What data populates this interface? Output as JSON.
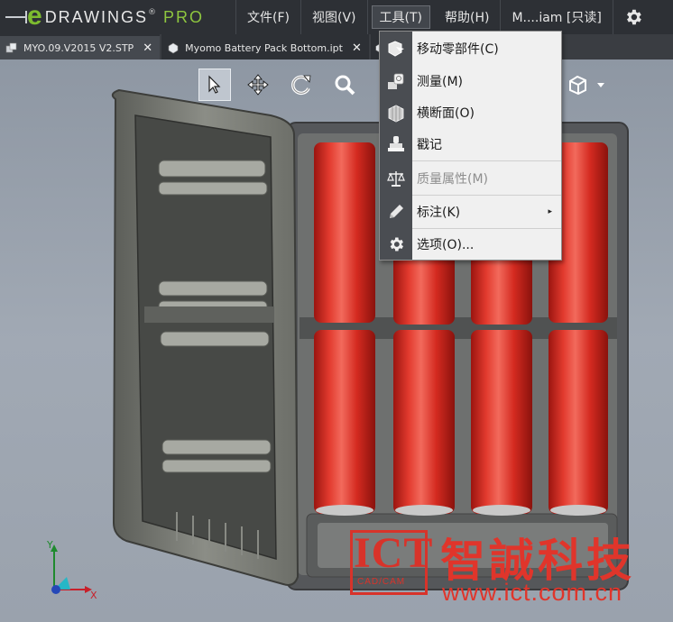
{
  "app": {
    "logo_e": "e",
    "logo_drawings": "DRAWINGS",
    "logo_reg": "®",
    "logo_pro": "PRO"
  },
  "menu": {
    "items": [
      {
        "label": "文件(F)"
      },
      {
        "label": "视图(V)"
      },
      {
        "label": "工具(T)"
      },
      {
        "label": "帮助(H)"
      },
      {
        "label": "M....iam [只读]"
      }
    ],
    "gear_icon": "gear-icon"
  },
  "tabs": [
    {
      "label": "MYO.09.V2015 V2.STP",
      "close": "✕"
    },
    {
      "label": "Myomo Battery Pack Bottom.ipt",
      "close": "✕"
    }
  ],
  "toolbar": {
    "icons": [
      "select-arrow-icon",
      "pan-icon",
      "rotate-icon",
      "zoom-fit-icon",
      "view-cube-icon",
      "dropdown-caret-icon"
    ]
  },
  "tools_menu": {
    "items": [
      {
        "label": "移动零部件(C)",
        "icon": "move-component-icon",
        "disabled": false
      },
      {
        "label": "测量(M)",
        "icon": "measure-icon",
        "disabled": false
      },
      {
        "label": "横断面(O)",
        "icon": "section-icon",
        "disabled": false
      },
      {
        "label": "戳记",
        "icon": "stamp-icon",
        "disabled": false
      },
      {
        "label": "质量属性(M)",
        "icon": "mass-properties-icon",
        "disabled": true
      },
      {
        "label": "标注(K)",
        "icon": "markup-pencil-icon",
        "disabled": false,
        "submenu_arrow": "▸"
      },
      {
        "label": "选项(O)...",
        "icon": "options-gear-icon",
        "disabled": false
      }
    ]
  },
  "triad": {
    "y_label": "Y",
    "x_label": "X"
  },
  "watermark": {
    "logo_text": "ICT",
    "logo_sub": "CAD/CAM",
    "company": "智誠科技",
    "url": "www.ict.com.cn"
  },
  "colors": {
    "accent_green": "#7dbb2f",
    "battery_red": "#d42a20",
    "watermark_red": "#e0352b",
    "annotation_arrow": "#e8392a"
  }
}
